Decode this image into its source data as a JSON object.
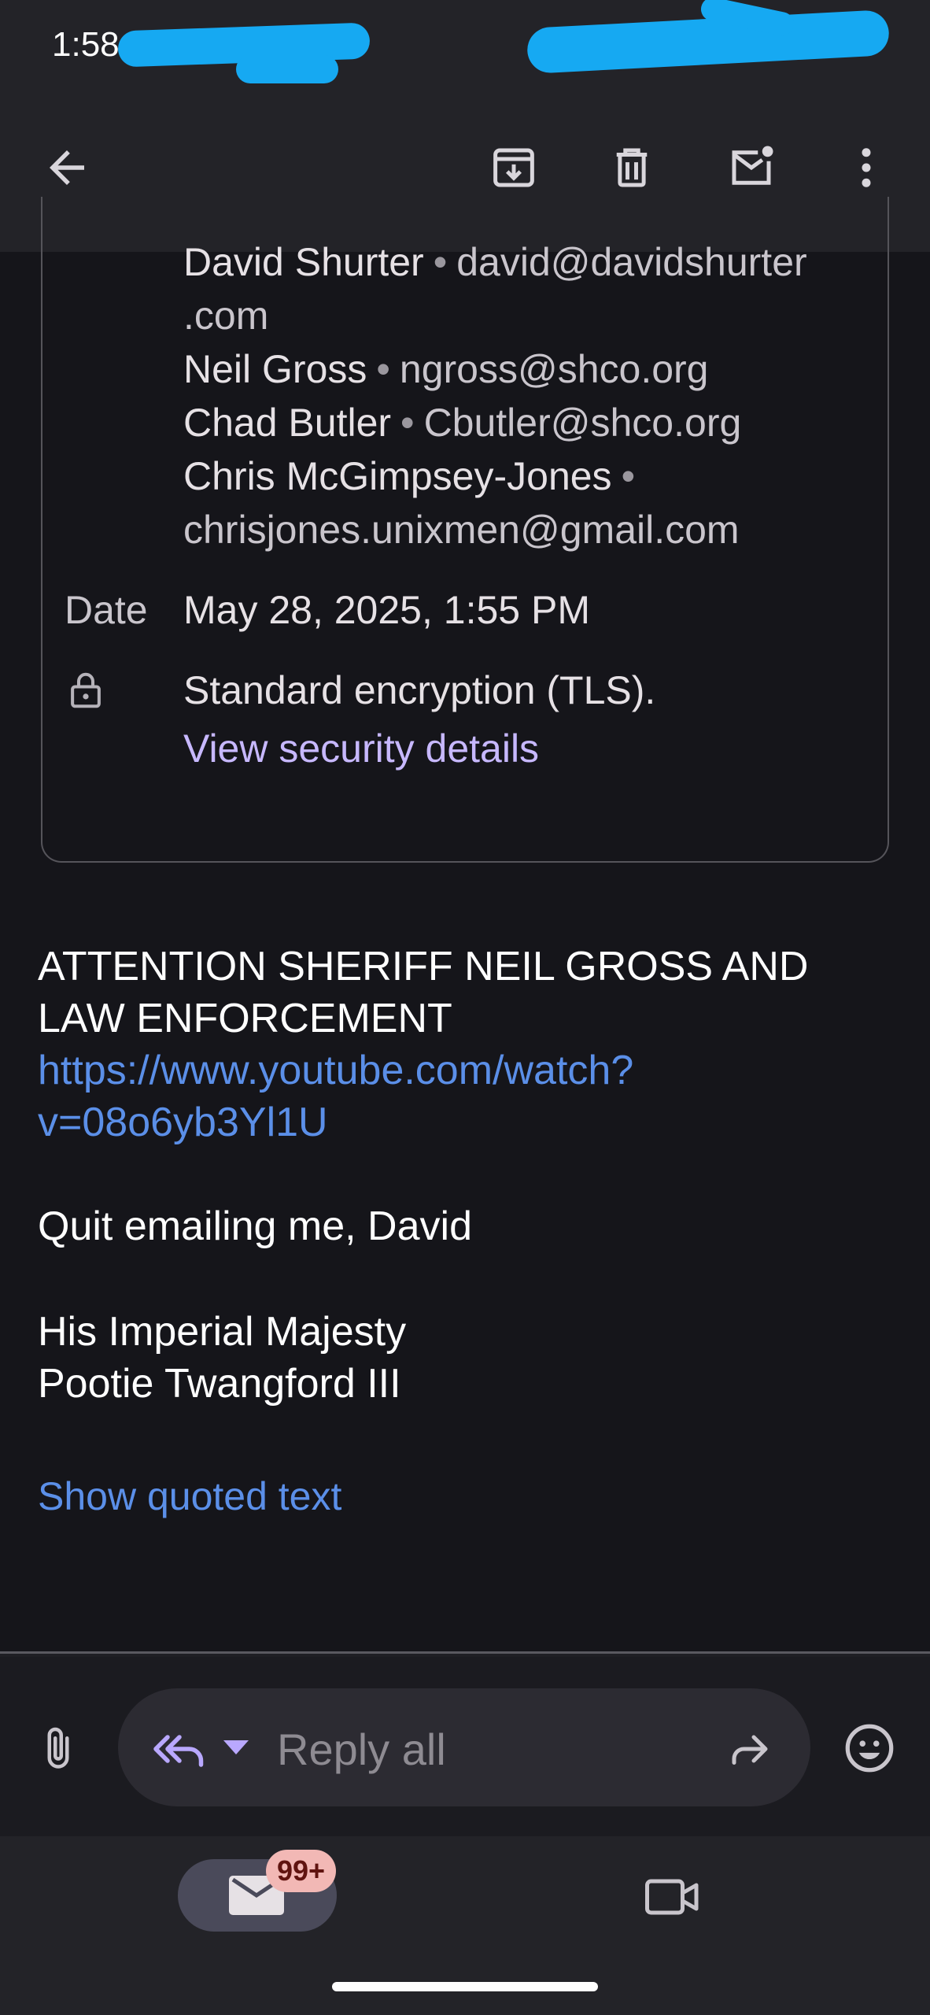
{
  "status_bar": {
    "time": "1:58"
  },
  "app_bar": {
    "back_icon": "arrow-back-icon",
    "archive_icon": "archive-icon",
    "delete_icon": "trash-icon",
    "mark_unread_icon": "mark-unread-icon",
    "more_icon": "more-vert-icon"
  },
  "details": {
    "recipients": [
      {
        "name": "David Shurter",
        "email": "david@davidshurter",
        "email_cont": ".com"
      },
      {
        "name": "Neil Gross",
        "email": "ngross@shco.org"
      },
      {
        "name": "Chad Butler",
        "email": "Cbutler@shco.org"
      },
      {
        "name": "Chris McGimpsey-Jones",
        "email": "chrisjones.unixmen@gmail.com"
      }
    ],
    "date_label": "Date",
    "date_value": "May 28, 2025, 1:55 PM",
    "encryption": "Standard encryption (TLS).",
    "security_link": "View security details"
  },
  "body": {
    "line1": "ATTENTION SHERIFF NEIL GROSS AND",
    "line2": "LAW ENFORCEMENT",
    "link_line1": "https://www.youtube.com/watch?",
    "link_line2": "v=08o6yb3Yl1U",
    "line3": "Quit emailing me, David",
    "sig1": "His Imperial Majesty",
    "sig2": "Pootie Twangford III",
    "show_quoted": "Show quoted text"
  },
  "reply_bar": {
    "placeholder": "Reply all"
  },
  "bottom_nav": {
    "mail_badge": "99+"
  },
  "colors": {
    "background": "#15151a",
    "bar": "#232328",
    "link_blue": "#5b8fe8",
    "security_link": "#c7b8ff",
    "redaction": "#16a9f2"
  }
}
